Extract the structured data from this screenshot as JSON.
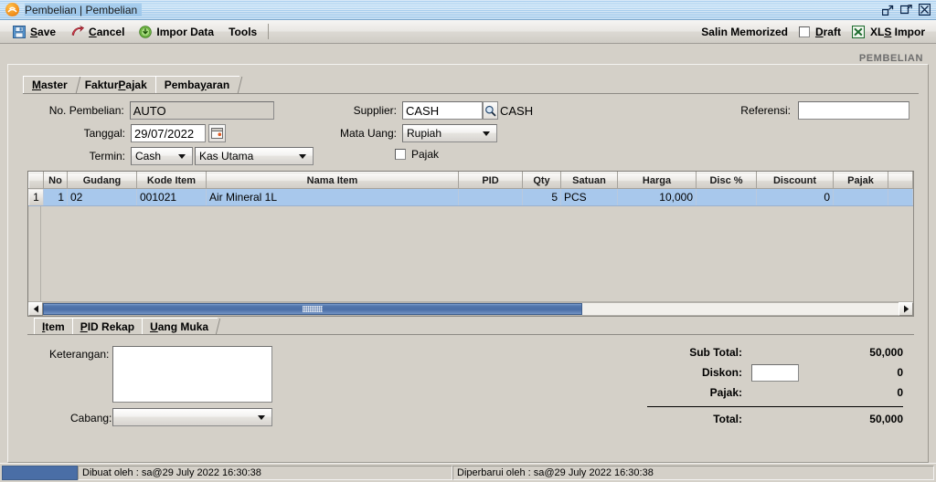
{
  "window": {
    "title": "Pembelian | Pembelian",
    "app_icon": "orange-circle-icon",
    "controls": [
      {
        "name": "restore-down-icon",
        "label": "Restore Down"
      },
      {
        "name": "maximize-icon",
        "label": "Maximize"
      },
      {
        "name": "close-icon",
        "label": "Close"
      }
    ]
  },
  "toolbar": {
    "save": "Save",
    "save_accel": "S",
    "cancel": "Cancel",
    "cancel_accel": "C",
    "impor_data": "Impor Data",
    "tools": "Tools",
    "salin_memorized": "Salin Memorized",
    "draft": "Draft",
    "draft_accel": "D",
    "xls_impor": "XLS Impor",
    "xls_accel": "L"
  },
  "page": {
    "title": "PEMBELIAN"
  },
  "tabs": {
    "items": [
      {
        "label": "Master",
        "accel": "M",
        "active": true
      },
      {
        "label": "Faktur Pajak",
        "accel": "P",
        "active": false
      },
      {
        "label": "Pembayaran",
        "accel": "y",
        "active": false
      }
    ]
  },
  "form": {
    "no_pembelian_label": "No. Pembelian:",
    "no_pembelian_value": "AUTO",
    "tanggal_label": "Tanggal:",
    "tanggal_value": "29/07/2022",
    "calendar_icon": "calendar-icon",
    "termin_label": "Termin:",
    "termin_value": "Cash",
    "termin_account_value": "Kas Utama",
    "supplier_label": "Supplier:",
    "supplier_value": "CASH",
    "supplier_search_icon": "search-icon",
    "supplier_name": "CASH",
    "mata_uang_label": "Mata Uang:",
    "mata_uang_value": "Rupiah",
    "pajak_label": "Pajak",
    "pajak_checked": false,
    "referensi_label": "Referensi:",
    "referensi_value": ""
  },
  "grid": {
    "columns": [
      "No",
      "Gudang",
      "Kode Item",
      "Nama Item",
      "PID",
      "Qty",
      "Satuan",
      "Harga",
      "Disc %",
      "Discount",
      "Pajak",
      ""
    ],
    "rows": [
      {
        "row_header": "1",
        "no": "1",
        "gudang": "02",
        "kode_item": "001021",
        "nama_item": "Air Mineral 1L",
        "pid": "",
        "qty": "5",
        "satuan": "PCS",
        "harga": "10,000",
        "disc_pct": "",
        "discount": "0",
        "pajak": "",
        "extra": ""
      }
    ],
    "hscroll": {
      "left_arrow_icon": "arrow-left-icon",
      "right_arrow_icon": "arrow-right-icon"
    }
  },
  "bottom_tabs": {
    "items": [
      {
        "label": "Item",
        "accel": "I",
        "active": true
      },
      {
        "label": "PID Rekap",
        "accel": "P",
        "active": false
      },
      {
        "label": "Uang Muka",
        "accel": "U",
        "active": false
      }
    ]
  },
  "bottom": {
    "keterangan_label": "Keterangan:",
    "keterangan_value": "",
    "cabang_label": "Cabang:",
    "cabang_value": ""
  },
  "totals": {
    "sub_total_label": "Sub Total:",
    "sub_total_value": "50,000",
    "diskon_label": "Diskon:",
    "diskon_input_value": "",
    "diskon_value": "0",
    "pajak_label": "Pajak:",
    "pajak_value": "0",
    "total_label": "Total:",
    "total_value": "50,000"
  },
  "statusbar": {
    "created": "Dibuat oleh : sa@29 July 2022  16:30:38",
    "updated": "Diperbarui oleh : sa@29 July 2022  16:30:38"
  },
  "colors": {
    "titlebar": "#a8ceee",
    "selection": "#a8c8ec",
    "scrollbar_thumb": "#4a6ea6",
    "face": "#d4d0c8",
    "page_title": "#6d6d6d"
  }
}
